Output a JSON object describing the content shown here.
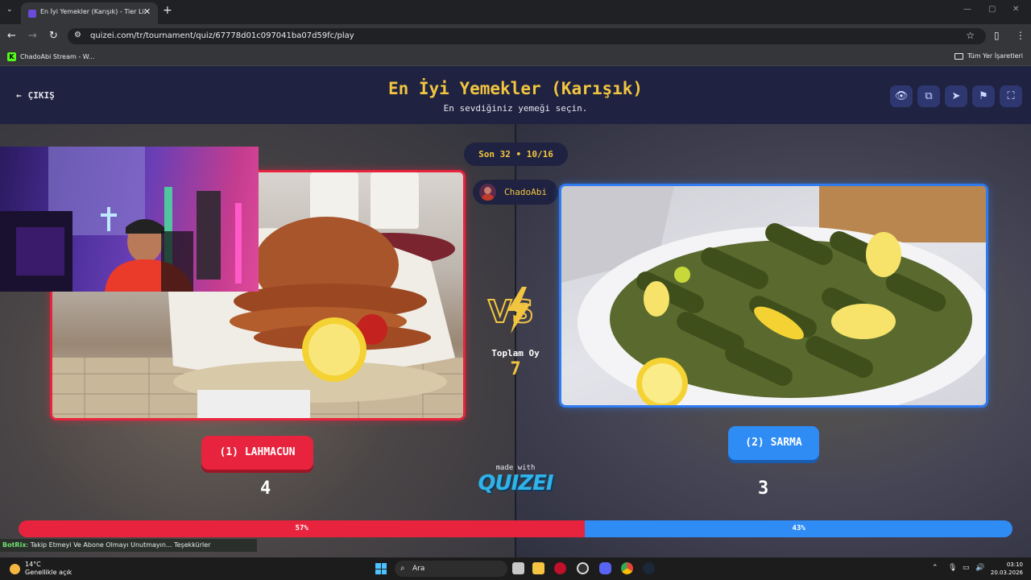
{
  "browser": {
    "tab_title": "En İyi Yemekler (Karışık) - Tier List Maker",
    "url": "quizei.com/tr/tournament/quiz/67778d01c097041ba07d59fc/play",
    "bookmarks": {
      "stream": "ChadoAbi Stream - W...",
      "all": "Tüm Yer İşaretleri"
    }
  },
  "header": {
    "exit_label": "ÇIKIŞ",
    "title": "En İyi Yemekler (Karışık)",
    "subtitle": "En sevdiğiniz yemeği seçin."
  },
  "round": {
    "label": "Son 32 • 10/16"
  },
  "user": {
    "name": "ChadoAbi"
  },
  "left": {
    "label": "(1) LAHMACUN",
    "votes": "4",
    "percent": 57,
    "percent_label": "57%"
  },
  "right": {
    "label": "(2) SARMA",
    "votes": "3",
    "percent": 43,
    "percent_label": "43%"
  },
  "center": {
    "total_votes_label": "Toplam Oy",
    "total_votes": "7",
    "made_with": "made with",
    "brand": "QUIZEI"
  },
  "ticker": {
    "user": "BotRix",
    "message": ": Takip Etmeyi Ve Abone Olmayı Unutmayın... Teşekkürler"
  },
  "taskbar": {
    "temperature": "14°C",
    "weather": "Genellikle açık",
    "search_placeholder": "Ara",
    "time": "03:10",
    "date": "20.03.2026"
  },
  "colors": {
    "accent_yellow": "#f2c541",
    "left_red": "#e8233d",
    "right_blue": "#2f8cf5",
    "header_bg": "#1f2240"
  }
}
